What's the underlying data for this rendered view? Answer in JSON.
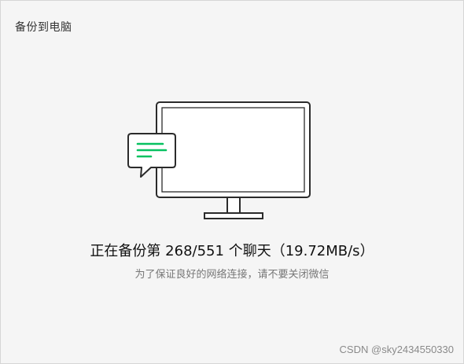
{
  "window": {
    "title": "备份到电脑"
  },
  "illustration": {
    "icon": "monitor-with-chat-bubble",
    "accent_color": "#07c160"
  },
  "status": {
    "prefix": "正在备份第",
    "current": "268",
    "total": "551",
    "suffix": "个聊天",
    "speed": "19.72MB/s",
    "hint": "为了保证良好的网络连接，请不要关闭微信"
  },
  "watermark": {
    "text": "CSDN @sky2434550330"
  }
}
